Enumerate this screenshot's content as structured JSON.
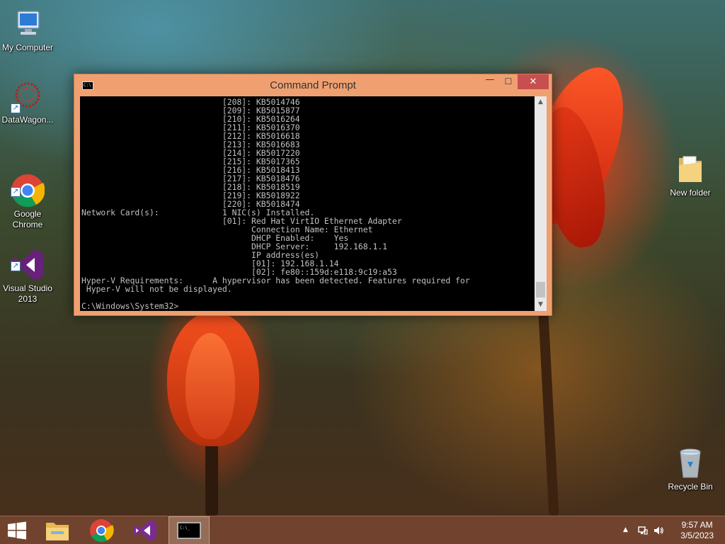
{
  "desktop": {
    "icons": [
      {
        "label": "My Computer"
      },
      {
        "label": "DataWagon..."
      },
      {
        "label": "Google\nChrome"
      },
      {
        "label": "Visual Studio\n2013"
      },
      {
        "label": "New folder"
      },
      {
        "label": "Recycle Bin"
      }
    ]
  },
  "window": {
    "title": "Command Prompt",
    "icon_text": "C:\\",
    "buttons": {
      "minimize": "—",
      "maximize": "☐",
      "close": "✕"
    },
    "console_lines": [
      "                             [208]: KB5014746",
      "                             [209]: KB5015877",
      "                             [210]: KB5016264",
      "                             [211]: KB5016370",
      "                             [212]: KB5016618",
      "                             [213]: KB5016683",
      "                             [214]: KB5017220",
      "                             [215]: KB5017365",
      "                             [216]: KB5018413",
      "                             [217]: KB5018476",
      "                             [218]: KB5018519",
      "                             [219]: KB5018922",
      "                             [220]: KB5018474",
      "Network Card(s):             1 NIC(s) Installed.",
      "                             [01]: Red Hat VirtIO Ethernet Adapter",
      "                                   Connection Name: Ethernet",
      "                                   DHCP Enabled:    Yes",
      "                                   DHCP Server:     192.168.1.1",
      "                                   IP address(es)",
      "                                   [01]: 192.168.1.14",
      "                                   [02]: fe80::159d:e118:9c19:a53",
      "Hyper-V Requirements:      A hypervisor has been detected. Features required for",
      " Hyper-V will not be displayed.",
      "",
      "C:\\Windows\\System32>"
    ]
  },
  "taskbar": {
    "apps": [
      {
        "name": "file-explorer"
      },
      {
        "name": "google-chrome"
      },
      {
        "name": "visual-studio"
      },
      {
        "name": "command-prompt"
      }
    ],
    "tray": {
      "chevron": "▲"
    },
    "clock": {
      "time": "9:57 AM",
      "date": "3/5/2023"
    }
  },
  "colors": {
    "window_frame": "#f0a070",
    "close_button": "#c74f4f",
    "console_bg": "#000000",
    "console_fg": "#c0c0c0",
    "taskbar": "#784632"
  }
}
